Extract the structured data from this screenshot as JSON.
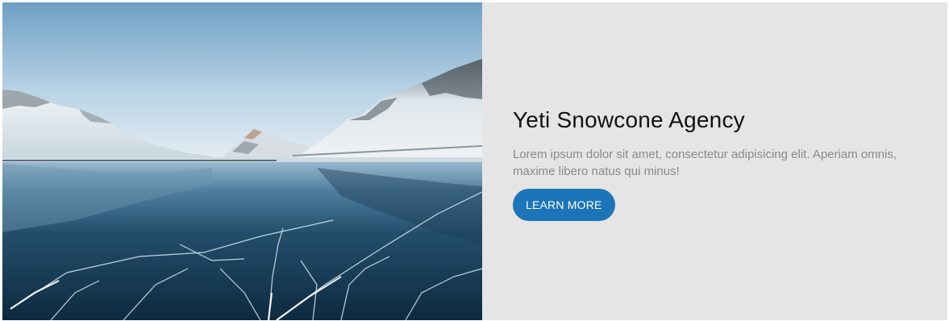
{
  "hero": {
    "image": {
      "subject": "frozen-lake-mountains-photo"
    },
    "title": "Yeti Snowcone Agency",
    "description": "Lorem ipsum dolor sit amet, consectetur adipisicing elit. Aperiam omnis, maxime libero natus qui minus!",
    "cta_label": "LEARN MORE"
  },
  "colors": {
    "panel_background": "#e5e5e5",
    "button_background": "#1c75b8",
    "button_text": "#ffffff",
    "title_text": "#111111",
    "body_text": "#8a8a8a"
  }
}
